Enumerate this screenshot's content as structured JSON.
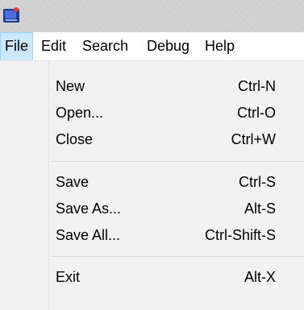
{
  "titlebar": {
    "app_icon": "app-icon",
    "accent_color": "#1e3a8a"
  },
  "menubar": {
    "items": [
      {
        "label": "File"
      },
      {
        "label": "Edit"
      },
      {
        "label": "Search"
      },
      {
        "label": "Debug"
      },
      {
        "label": "Help"
      }
    ],
    "active_index": 0,
    "active_bg": "#cce8ff"
  },
  "file_menu": {
    "groups": [
      [
        {
          "label": "New",
          "shortcut": "Ctrl-N"
        },
        {
          "label": "Open...",
          "shortcut": "Ctrl-O"
        },
        {
          "label": "Close",
          "shortcut": "Ctrl+W"
        }
      ],
      [
        {
          "label": "Save",
          "shortcut": "Ctrl-S"
        },
        {
          "label": "Save As...",
          "shortcut": "Alt-S"
        },
        {
          "label": "Save All...",
          "shortcut": "Ctrl-Shift-S"
        }
      ],
      [
        {
          "label": "Exit",
          "shortcut": "Alt-X"
        }
      ]
    ]
  }
}
